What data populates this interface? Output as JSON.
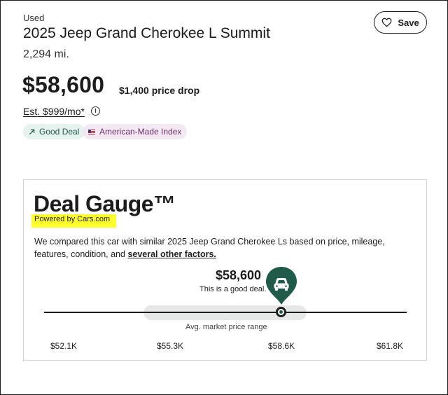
{
  "listing": {
    "condition": "Used",
    "title": "2025 Jeep Grand Cherokee L Summit",
    "mileage": "2,294 mi.",
    "price": "$58,600",
    "price_drop": "$1,400 price drop",
    "est_payment": "Est. $999/mo*",
    "save_label": "Save",
    "badges": [
      {
        "label": "Good Deal",
        "icon": "trend-up-arrow-icon"
      },
      {
        "label": "American-Made Index",
        "icon": "us-flag-icon"
      }
    ]
  },
  "deal_gauge": {
    "title": "Deal Gauge™",
    "powered_by": "Powered by Cars.com",
    "description_prefix": "We compared this car with similar 2025 Jeep Grand Cherokee Ls based on price, mileage, features, condition, and ",
    "description_link": "several other factors.",
    "price": "$58,600",
    "deal_text": "This is a good deal.",
    "range_label": "Avg. market price range",
    "ticks": [
      "$52.1K",
      "$55.3K",
      "$58.6K",
      "$61.8K"
    ],
    "marker_icon": "car-pin-icon",
    "colors": {
      "accent": "#1f5a4b",
      "range_band": "#e5e8e7"
    }
  }
}
